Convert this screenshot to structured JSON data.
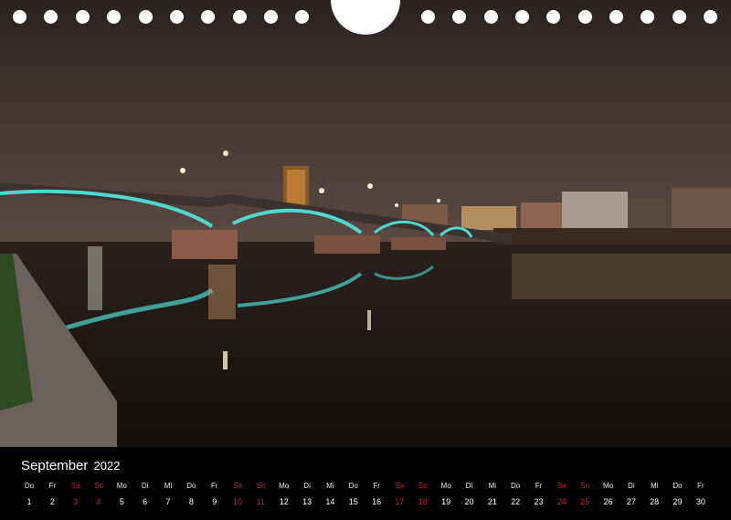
{
  "calendar": {
    "month": "September",
    "year": "2022",
    "weekend_color": "#c0262c",
    "days": [
      {
        "wd": "Do",
        "d": "1",
        "we": false
      },
      {
        "wd": "Fr",
        "d": "2",
        "we": false
      },
      {
        "wd": "Sa",
        "d": "3",
        "we": true
      },
      {
        "wd": "So",
        "d": "4",
        "we": true
      },
      {
        "wd": "Mo",
        "d": "5",
        "we": false
      },
      {
        "wd": "Di",
        "d": "6",
        "we": false
      },
      {
        "wd": "Mi",
        "d": "7",
        "we": false
      },
      {
        "wd": "Do",
        "d": "8",
        "we": false
      },
      {
        "wd": "Fr",
        "d": "9",
        "we": false
      },
      {
        "wd": "Sa",
        "d": "10",
        "we": true
      },
      {
        "wd": "So",
        "d": "11",
        "we": true
      },
      {
        "wd": "Mo",
        "d": "12",
        "we": false
      },
      {
        "wd": "Di",
        "d": "13",
        "we": false
      },
      {
        "wd": "Mi",
        "d": "14",
        "we": false
      },
      {
        "wd": "Do",
        "d": "15",
        "we": false
      },
      {
        "wd": "Fr",
        "d": "16",
        "we": false
      },
      {
        "wd": "Sa",
        "d": "17",
        "we": true
      },
      {
        "wd": "So",
        "d": "18",
        "we": true
      },
      {
        "wd": "Mo",
        "d": "19",
        "we": false
      },
      {
        "wd": "Di",
        "d": "20",
        "we": false
      },
      {
        "wd": "Mi",
        "d": "21",
        "we": false
      },
      {
        "wd": "Do",
        "d": "22",
        "we": false
      },
      {
        "wd": "Fr",
        "d": "23",
        "we": false
      },
      {
        "wd": "Sa",
        "d": "24",
        "we": true
      },
      {
        "wd": "So",
        "d": "25",
        "we": true
      },
      {
        "wd": "Mo",
        "d": "26",
        "we": false
      },
      {
        "wd": "Di",
        "d": "27",
        "we": false
      },
      {
        "wd": "Mi",
        "d": "28",
        "we": false
      },
      {
        "wd": "Do",
        "d": "29",
        "we": false
      },
      {
        "wd": "Fr",
        "d": "30",
        "we": false
      }
    ]
  },
  "photo": {
    "subject": "illuminated-arch-bridge-over-river-at-night",
    "sky_color": "#3a2e2b",
    "water_color": "#1d1613",
    "bridge_light_color": "#4fd8d0",
    "city_light_color": "#f3c98a"
  }
}
